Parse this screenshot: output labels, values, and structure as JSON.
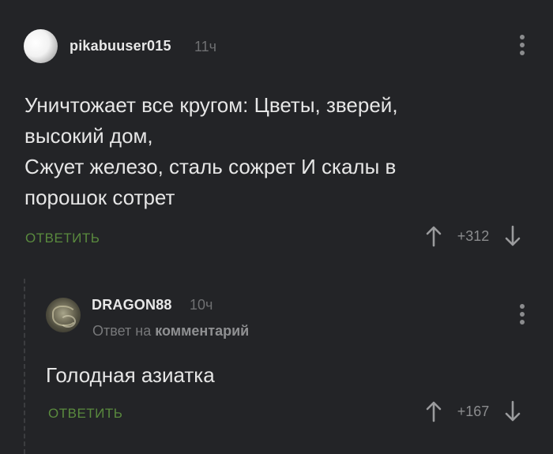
{
  "comment": {
    "author": "pikabuuser015",
    "time": "11ч",
    "text": "Уничтожает все кругом: Цветы, зверей,\nвысокий дом,\nСжует железо, сталь сожрет И скалы в\nпорошок сотрет",
    "reply_label": "ОТВЕТИТЬ",
    "score": "+312"
  },
  "reply": {
    "author": "DRAGON88",
    "time": "10ч",
    "reply_to_prefix": "Ответ на",
    "reply_to_link": "комментарий",
    "text": "Голодная азиатка",
    "reply_label": "ОТВЕТИТЬ",
    "score": "+167"
  },
  "icons": {
    "upvote": "arrow-up-icon",
    "downvote": "arrow-down-icon",
    "menu": "more-vertical-icon"
  },
  "colors": {
    "background": "#232427",
    "reply_accent": "#5a8a3e",
    "text": "#e6e6e6",
    "muted": "#8b8c8e"
  }
}
